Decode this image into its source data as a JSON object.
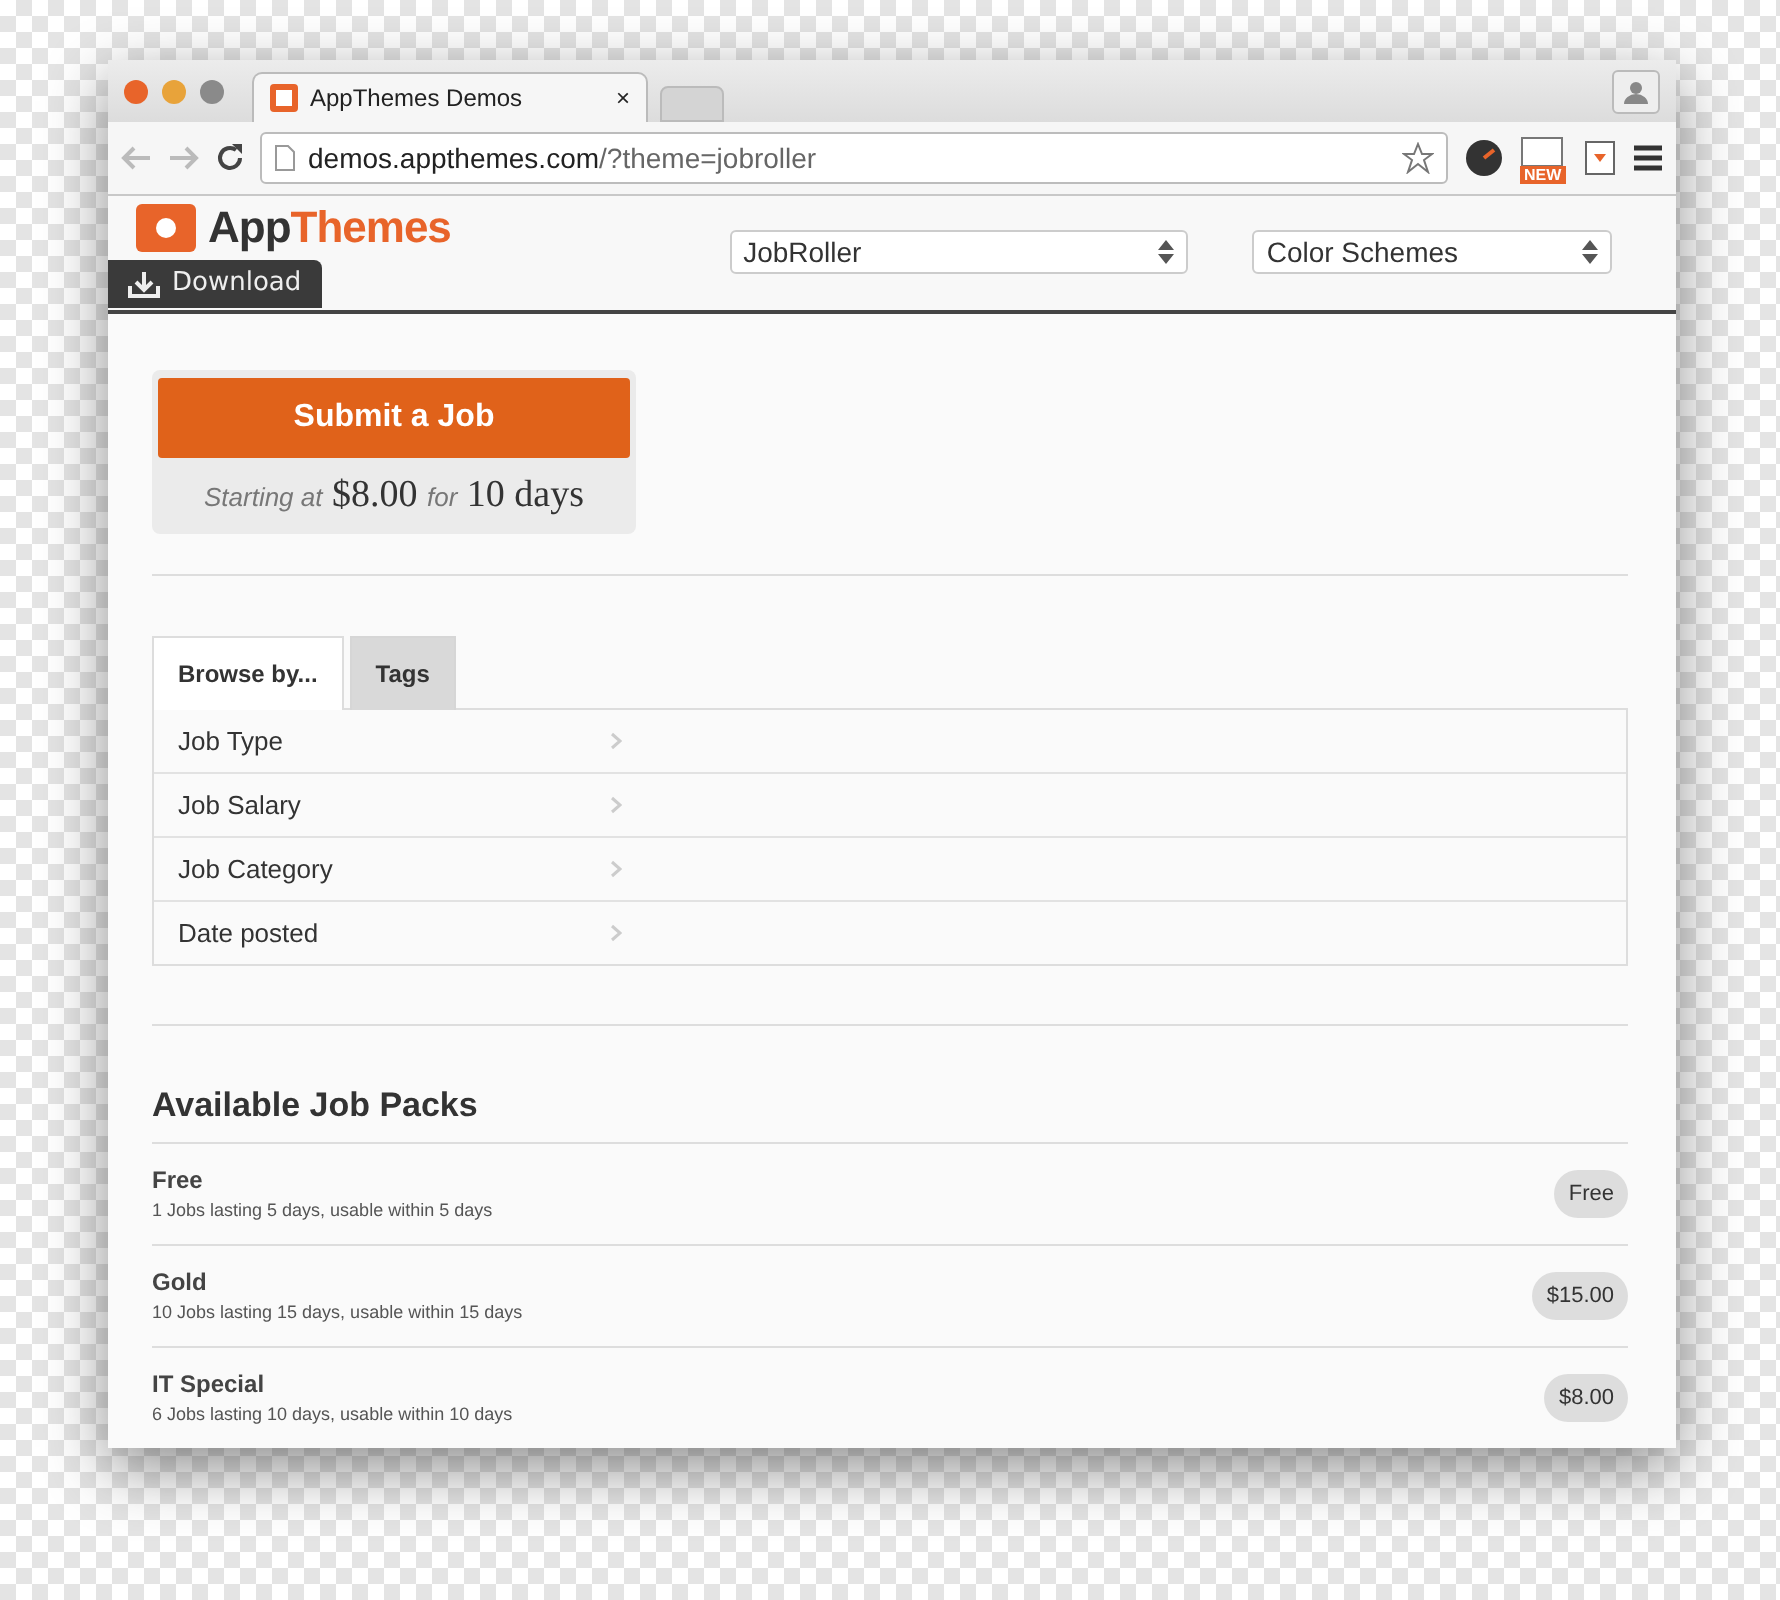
{
  "browser": {
    "tab_title": "AppThemes Demos",
    "tab_close": "×",
    "url_host": "demos.appthemes.com",
    "url_path": "/?theme=jobroller",
    "badge": "NEW"
  },
  "header": {
    "logo_left": "App",
    "logo_right": "Themes",
    "download": "Download",
    "theme_select": "JobRoller",
    "color_select": "Color Schemes"
  },
  "submit": {
    "button": "Submit a Job",
    "price_line": "*Starting at* $8.00 *for* 10 days"
  },
  "tabs": [
    {
      "label": "Browse by...",
      "selected": true
    },
    {
      "label": "Tags",
      "selected": false
    }
  ],
  "browse_items": [
    "Job Type",
    "Job Salary",
    "Job Category",
    "Date posted"
  ],
  "packs": {
    "title": "Available Job Packs",
    "items": [
      {
        "name": "Free",
        "detail": "1 Jobs lasting 5 days, usable within 5 days",
        "price": "Free"
      },
      {
        "name": "Gold",
        "detail": "10 Jobs lasting 15 days, usable within 15 days",
        "price": "$15.00"
      },
      {
        "name": "IT Special",
        "detail": "6 Jobs lasting 10 days, usable within 10 days",
        "price": "$8.00"
      }
    ]
  }
}
